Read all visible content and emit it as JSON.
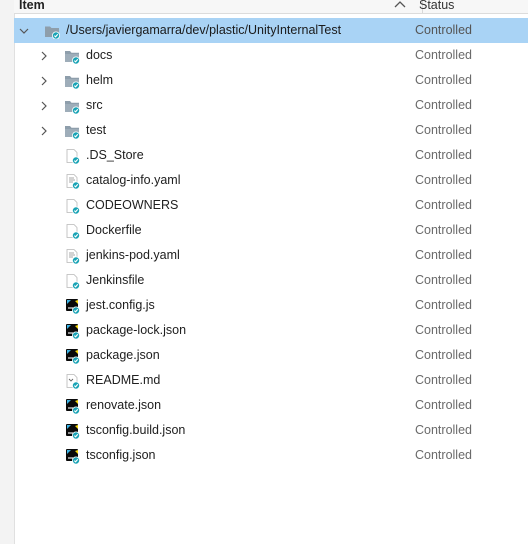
{
  "header": {
    "item_label": "Item",
    "status_label": "Status"
  },
  "rows": [
    {
      "name": "/Users/javiergamarra/dev/plastic/UnityInternalTest",
      "status": "Controlled",
      "type": "root-folder",
      "expanded": true,
      "selected": true
    },
    {
      "name": "docs",
      "status": "Controlled",
      "type": "folder"
    },
    {
      "name": "helm",
      "status": "Controlled",
      "type": "folder"
    },
    {
      "name": "src",
      "status": "Controlled",
      "type": "folder"
    },
    {
      "name": "test",
      "status": "Controlled",
      "type": "folder"
    },
    {
      "name": ".DS_Store",
      "status": "Controlled",
      "type": "file"
    },
    {
      "name": "catalog-info.yaml",
      "status": "Controlled",
      "type": "text-file"
    },
    {
      "name": "CODEOWNERS",
      "status": "Controlled",
      "type": "file"
    },
    {
      "name": "Dockerfile",
      "status": "Controlled",
      "type": "file"
    },
    {
      "name": "jenkins-pod.yaml",
      "status": "Controlled",
      "type": "text-file"
    },
    {
      "name": "Jenkinsfile",
      "status": "Controlled",
      "type": "file"
    },
    {
      "name": "jest.config.js",
      "status": "Controlled",
      "type": "jetbrains-file"
    },
    {
      "name": "package-lock.json",
      "status": "Controlled",
      "type": "jetbrains-file"
    },
    {
      "name": "package.json",
      "status": "Controlled",
      "type": "jetbrains-file"
    },
    {
      "name": "README.md",
      "status": "Controlled",
      "type": "markdown-file"
    },
    {
      "name": "renovate.json",
      "status": "Controlled",
      "type": "jetbrains-file"
    },
    {
      "name": "tsconfig.build.json",
      "status": "Controlled",
      "type": "jetbrains-file"
    },
    {
      "name": "tsconfig.json",
      "status": "Controlled",
      "type": "jetbrains-file"
    }
  ]
}
